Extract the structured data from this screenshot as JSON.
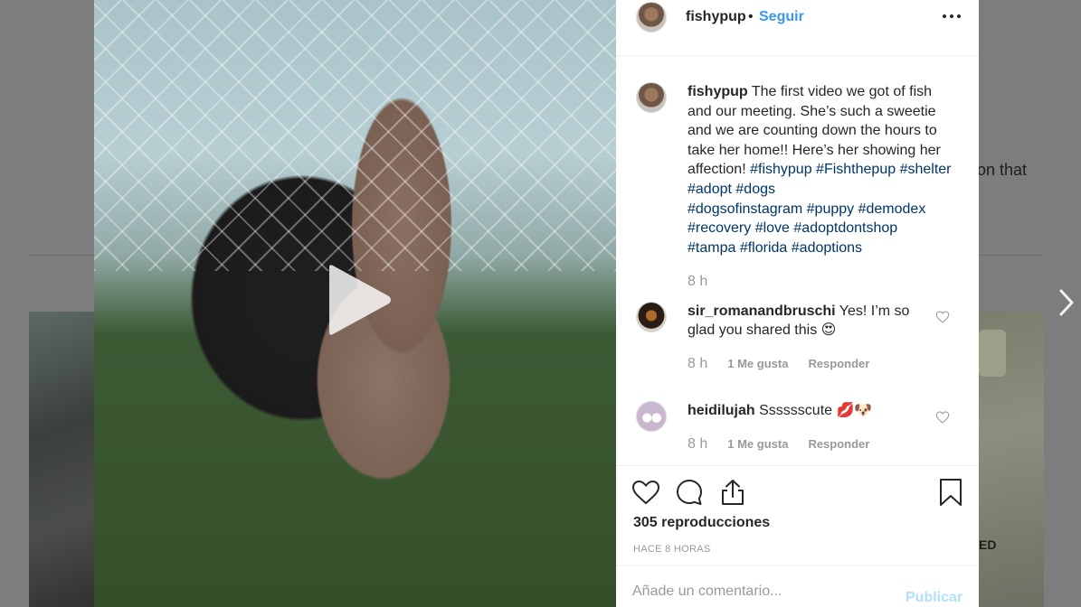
{
  "background": {
    "partial_text": "on that",
    "next_icon": "chevron-right-icon",
    "right_photo_code": "ED"
  },
  "post": {
    "header": {
      "username": "fishypup",
      "separator": "•",
      "follow_label": "Seguir",
      "more_icon": "more-options-icon"
    },
    "caption": {
      "username": "fishypup",
      "text": "The first video we got of fish and our meeting. She’s such a sweetie and we are counting down the hours to take her home!! Here’s her showing her affection!",
      "hashtags": [
        "#fishypup",
        "#Fishthepup",
        "#shelter",
        "#adopt",
        "#dogs",
        "#dogsofinstagram",
        "#puppy",
        "#demodex",
        "#recovery",
        "#love",
        "#adoptdontshop",
        "#tampa",
        "#florida",
        "#adoptions"
      ],
      "time": "8 h"
    },
    "comments": [
      {
        "username": "sir_romanandbruschi",
        "text": "Yes! I’m so glad you shared this 😍",
        "time": "8 h",
        "likes": "1 Me gusta",
        "reply": "Responder"
      },
      {
        "username": "heidilujah",
        "text": "Sssssscute 💋🐶",
        "time": "8 h",
        "likes": "1 Me gusta",
        "reply": "Responder"
      }
    ],
    "actions": {
      "views": "305 reproducciones",
      "time_ago": "HACE 8 HORAS"
    },
    "add_comment": {
      "placeholder": "Añade un comentario...",
      "publish_label": "Publicar"
    }
  },
  "colors": {
    "link_blue": "#3897f0",
    "hashtag": "#003569",
    "muted": "#999999",
    "publish_disabled": "#b2dffc"
  }
}
